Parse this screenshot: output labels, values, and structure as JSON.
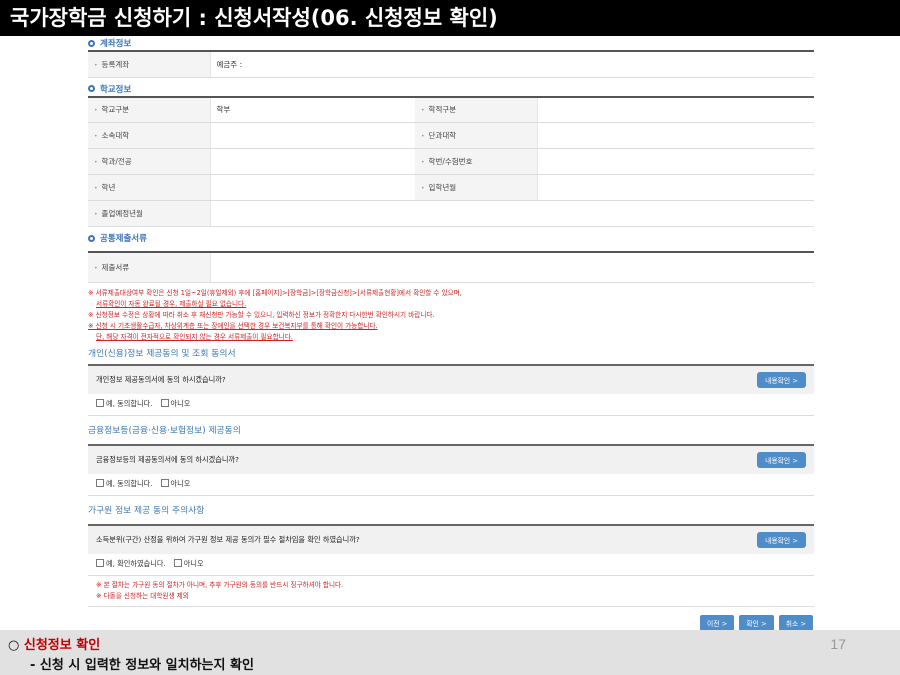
{
  "slide": {
    "title": "국가장학금 신청하기 : 신청서작성(06. 신청정보 확인)",
    "page_number": "17"
  },
  "account": {
    "heading": "계좌정보",
    "rows": [
      {
        "label": "등록계좌",
        "value": "예금주 :"
      }
    ]
  },
  "school": {
    "heading": "학교정보",
    "rows": [
      {
        "label1": "학교구분",
        "value1": "학부",
        "label2": "학적구분",
        "value2": ""
      },
      {
        "label1": "소속대학",
        "value1": "",
        "label2": "단과대학",
        "value2": ""
      },
      {
        "label1": "학과/전공",
        "value1": "",
        "label2": "학번/수험번호",
        "value2": ""
      },
      {
        "label1": "학년",
        "value1": "",
        "label2": "입학년월",
        "value2": ""
      },
      {
        "label1": "졸업예정년월",
        "value1": ""
      }
    ]
  },
  "docs": {
    "heading": "공통제출서류",
    "rows": [
      {
        "label": "제출서류",
        "value": ""
      }
    ]
  },
  "notes": [
    "※ 서류제출대상여부 확인은 신청 1일~2일(휴일제외) 후에 [홈페이지]>[장학금]>[장학금신청]>[서류제출현황]에서 확인할 수 있으며,",
    "서류확인이 자동 완료될 경우, 제출하실 필요 없습니다.",
    "※ 신청정보 수정은 상황에 따라 취소 후 재신청만 가능할 수 있으니, 입력하신 정보가 정확한지 다시한번 확인하시기 바랍니다.",
    "※ 신청 시 기초생활수급자, 차상위계층 또는 장애인을 선택한 경우 보건복지부를 통해 확인이 가능합니다.",
    "단, 해당 자격이 전자적으로 확인되지 않는 경우 서류제출이 필요합니다."
  ],
  "consent1": {
    "title": "개인(신용)정보 제공동의 및 조회 동의서",
    "question": "개인정보 제공동의서에 동의 하시겠습니까?",
    "button": "내용확인 >",
    "yes": "예, 동의합니다.",
    "no": "아니오"
  },
  "consent2": {
    "title": "금융정보등(금융·신용·보험정보) 제공동의",
    "question": "금융정보등의 제공동의서에 동의 하시겠습니까?",
    "button": "내용확인 >",
    "yes": "예, 동의합니다.",
    "no": "아니오"
  },
  "consent3": {
    "title": "가구원 정보 제공 동의 주의사항",
    "question": "소득분위(구간) 산정을 위하여 가구원 정보 제공 동의가 필수 절차임을 확인 하였습니까?",
    "button": "내용확인 >",
    "yes": "예, 확인하였습니다.",
    "no": "아니오",
    "notes": [
      "※ 본 절차는 가구원 동의 절차가 아니며, 추후 가구원의 동의를 반드시 징구하셔야 합니다.",
      "※ 다돌을 신청하는 대학원생 제외"
    ]
  },
  "actions": {
    "prev": "이전 >",
    "confirm": "확인 >",
    "cancel": "취소 >"
  },
  "footer": {
    "bullet": "○",
    "line1_title": "신청정보 확인",
    "line2": "- 신청 시 입력한 정보와 일치하는지 확인"
  }
}
